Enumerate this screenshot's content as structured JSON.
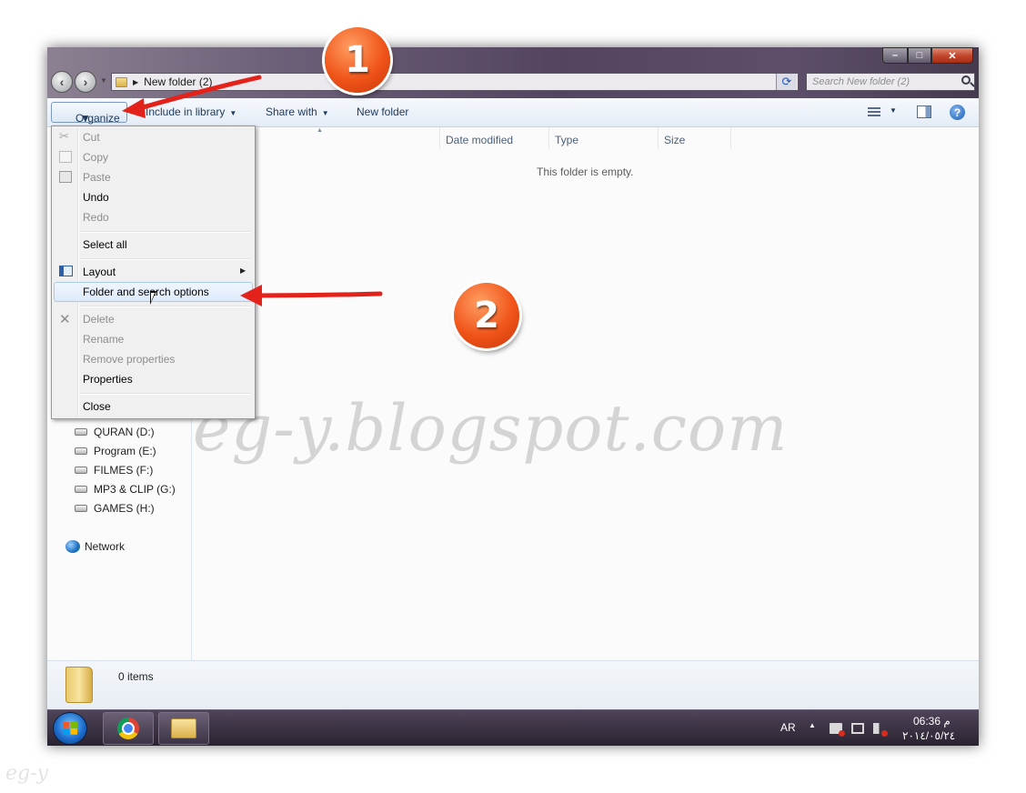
{
  "window": {
    "address": {
      "folder_label": "New folder (2)"
    },
    "search": {
      "placeholder": "Search New folder (2)"
    },
    "controls": {
      "minimize": "–",
      "maximize": "□",
      "close": "✕"
    }
  },
  "toolbar": {
    "organize_label": "Organize",
    "library_label": "Include in library",
    "share_label": "Share with",
    "newfolder_label": "New folder",
    "help_glyph": "?"
  },
  "columns": {
    "date_modified": "Date modified",
    "type": "Type",
    "size": "Size"
  },
  "content": {
    "empty_message": "This folder is empty."
  },
  "organize_menu": {
    "items": [
      {
        "label": "Cut",
        "enabled": false,
        "icon": "scissors-icon"
      },
      {
        "label": "Copy",
        "enabled": false,
        "icon": "copy-icon"
      },
      {
        "label": "Paste",
        "enabled": false,
        "icon": "paste-icon"
      },
      {
        "label": "Undo",
        "enabled": true
      },
      {
        "label": "Redo",
        "enabled": false
      },
      {
        "label": "Select all",
        "enabled": true
      },
      {
        "label": "Layout",
        "enabled": true,
        "icon": "layout-icon",
        "submenu": true
      },
      {
        "label": "Folder and search options",
        "enabled": true,
        "highlighted": true
      },
      {
        "label": "Delete",
        "enabled": false,
        "icon": "delete-icon"
      },
      {
        "label": "Rename",
        "enabled": false
      },
      {
        "label": "Remove properties",
        "enabled": false
      },
      {
        "label": "Properties",
        "enabled": true
      },
      {
        "label": "Close",
        "enabled": true
      }
    ]
  },
  "navpane": {
    "drives": [
      "QURAN (D:)",
      "Program (E:)",
      "FILMES (F:)",
      "MP3 & CLIP (G:)",
      "GAMES (H:)"
    ],
    "network": "Network"
  },
  "status": {
    "items_count": "0 items"
  },
  "taskbar": {
    "language": "AR",
    "time": "06:36 م",
    "date": "٢٠١٤/٠٥/٢٤"
  },
  "annotations": {
    "badge_1": "1",
    "badge_2": "2",
    "arrow_color": "#e3231b"
  },
  "watermark": "eg-y.blogspot.com",
  "corner_watermark": "eg-y"
}
